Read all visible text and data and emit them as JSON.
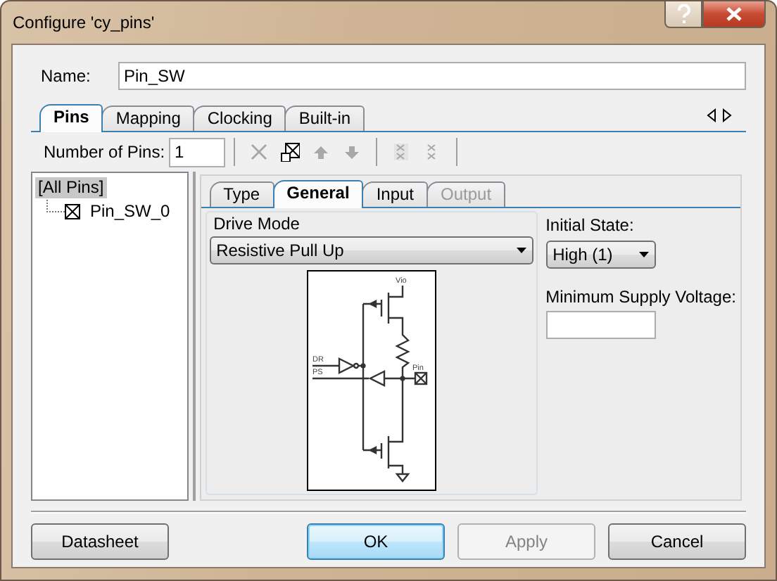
{
  "window": {
    "title": "Configure 'cy_pins'"
  },
  "name_field": {
    "label": "Name:",
    "value": "Pin_SW"
  },
  "tabs": [
    {
      "label": "Pins",
      "selected": true
    },
    {
      "label": "Mapping",
      "selected": false
    },
    {
      "label": "Clocking",
      "selected": false
    },
    {
      "label": "Built-in",
      "selected": false
    }
  ],
  "pins_toolbar": {
    "label": "Number of Pins:",
    "value": "1",
    "tools": [
      {
        "kind": "delete",
        "disabled": true
      },
      {
        "kind": "copy",
        "disabled": false
      },
      {
        "kind": "up",
        "disabled": true
      },
      {
        "kind": "down",
        "disabled": true
      },
      {
        "kind": "group",
        "disabled": true
      },
      {
        "kind": "ungroup",
        "disabled": true
      }
    ]
  },
  "pin_tree": [
    {
      "label": "[All Pins]",
      "selected": true,
      "children": [
        {
          "label": "Pin_SW_0",
          "selected": false
        }
      ]
    }
  ],
  "pin_tabs": [
    {
      "label": "Type",
      "selected": false,
      "disabled": false
    },
    {
      "label": "General",
      "selected": true,
      "disabled": false
    },
    {
      "label": "Input",
      "selected": false,
      "disabled": false
    },
    {
      "label": "Output",
      "selected": false,
      "disabled": true
    }
  ],
  "drive_mode": {
    "label": "Drive Mode",
    "value": "Resistive Pull Up",
    "schematic_labels": {
      "supply": "Vio",
      "dr": "DR",
      "ps": "PS",
      "pin": "Pin"
    }
  },
  "initial_state": {
    "label": "Initial State:",
    "value": "High (1)"
  },
  "min_supply_voltage": {
    "label": "Minimum Supply Voltage:"
  },
  "footer_buttons": [
    {
      "label": "Datasheet",
      "default": false,
      "disabled": false
    },
    {
      "label": "OK",
      "default": true,
      "disabled": false
    },
    {
      "label": "Apply",
      "default": false,
      "disabled": true
    },
    {
      "label": "Cancel",
      "default": false,
      "disabled": false
    }
  ]
}
